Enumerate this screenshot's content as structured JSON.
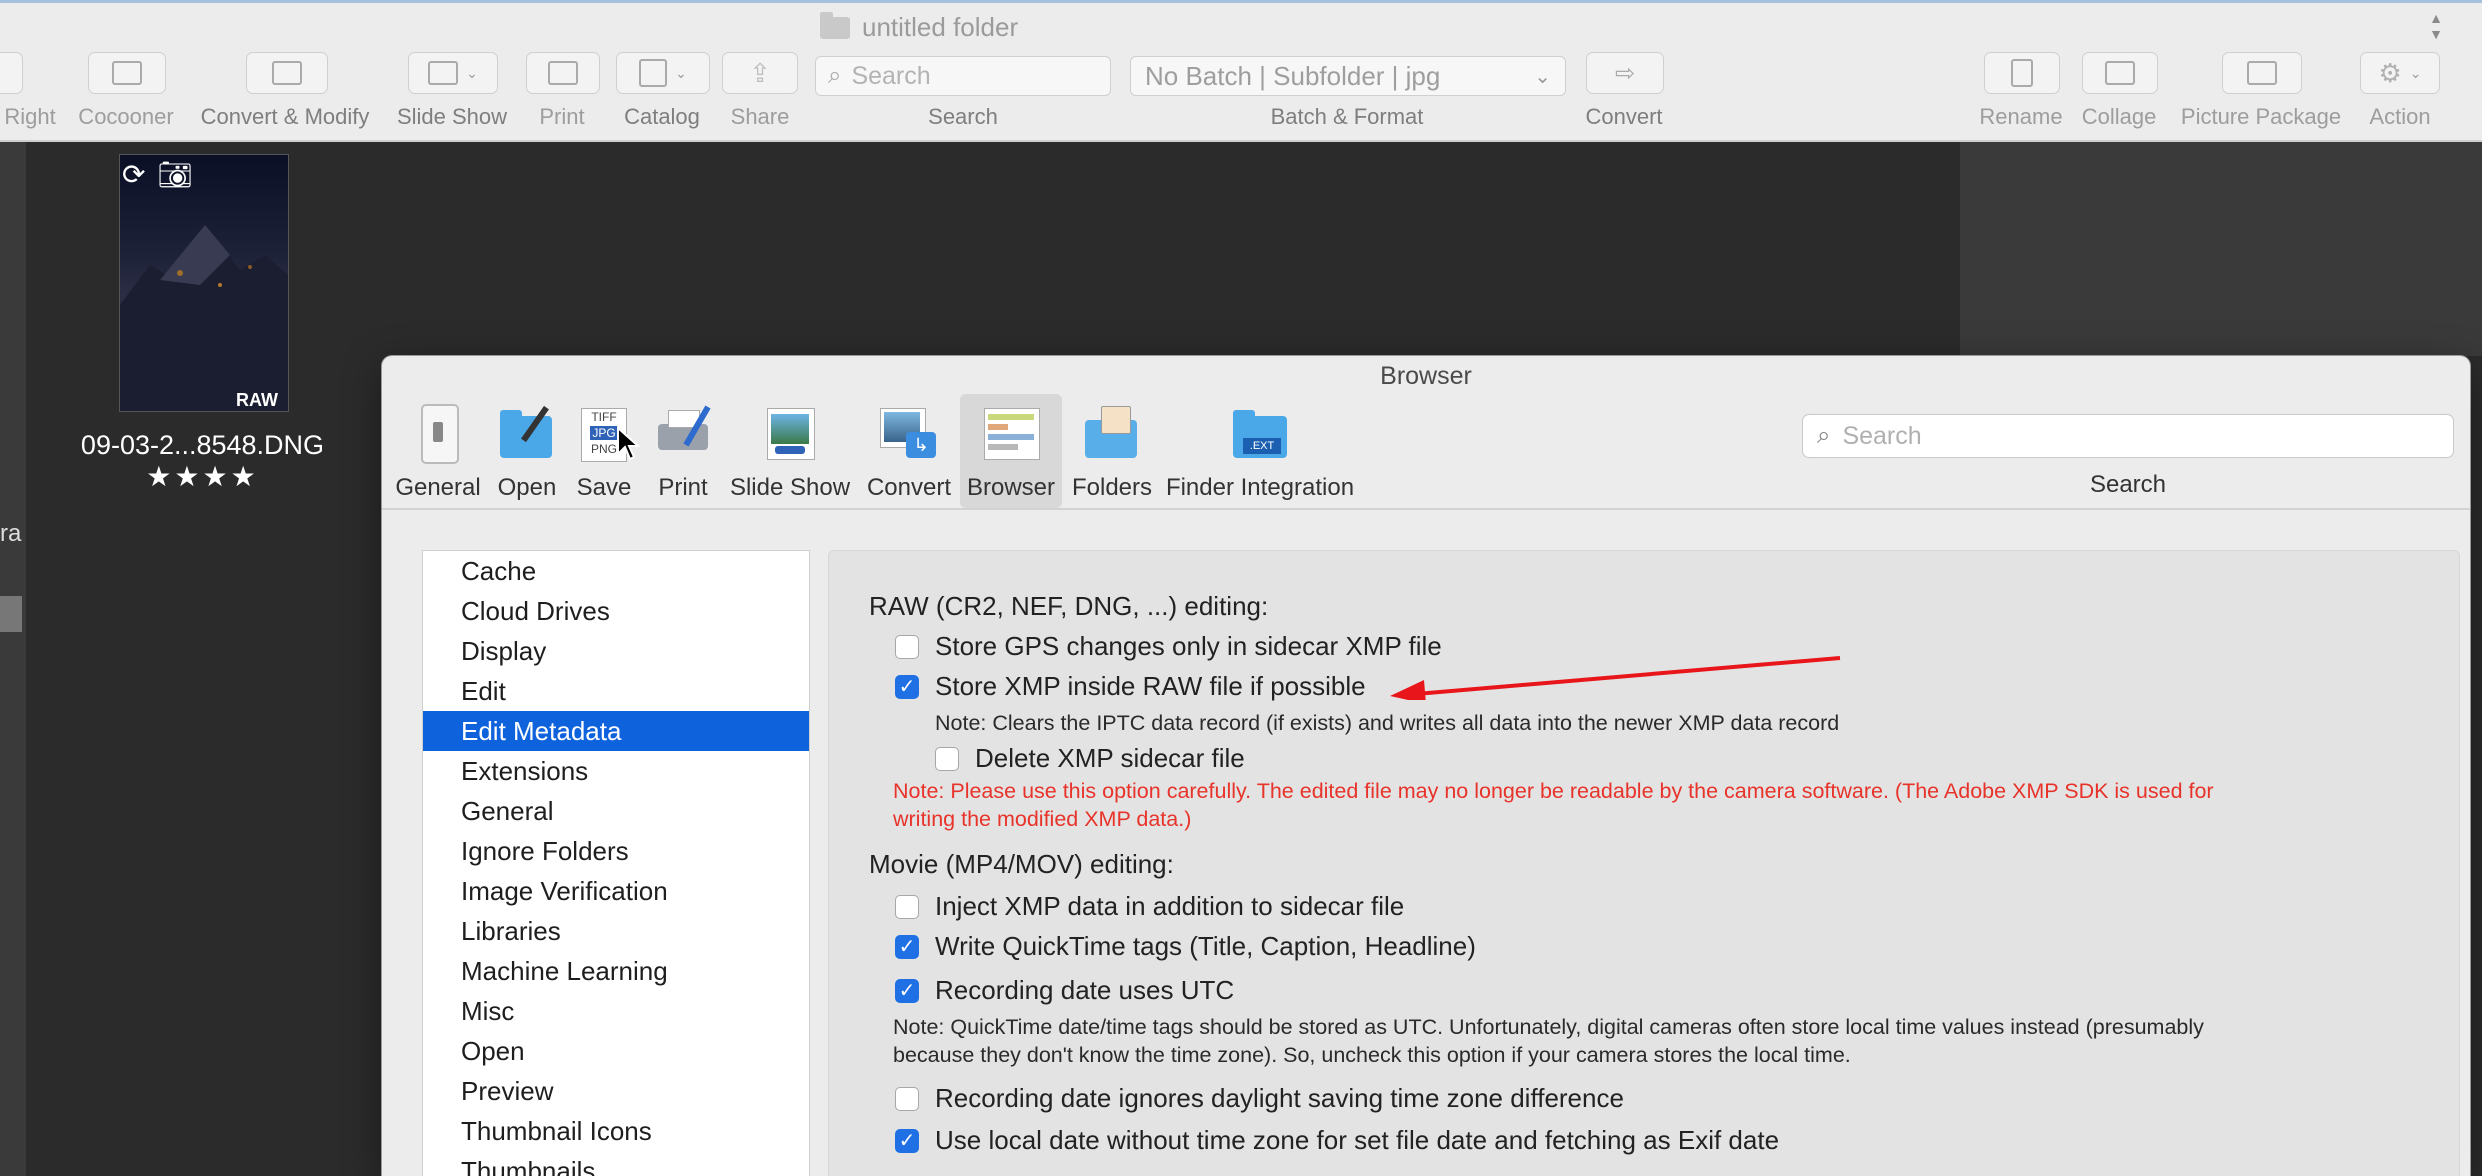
{
  "window": {
    "title": "untitled folder"
  },
  "toolbar": {
    "items": [
      {
        "label": "Right"
      },
      {
        "label": "Cocooner"
      },
      {
        "label": "Convert & Modify"
      },
      {
        "label": "Slide Show"
      },
      {
        "label": "Print"
      },
      {
        "label": "Catalog"
      },
      {
        "label": "Share"
      },
      {
        "label": "Search"
      },
      {
        "label": "Batch & Format"
      },
      {
        "label": "Convert"
      },
      {
        "label": "Rename"
      },
      {
        "label": "Collage"
      },
      {
        "label": "Picture Package"
      },
      {
        "label": "Action"
      }
    ],
    "search_placeholder": "Search",
    "batch_value": "No Batch | Subfolder | jpg"
  },
  "browser_area": {
    "left_text": "ra",
    "thumbnail": {
      "filename": "09-03-2...8548.DNG",
      "badge": "RAW",
      "rating_stars": "★★★★"
    }
  },
  "prefs": {
    "title": "Browser",
    "tabs": [
      {
        "label": "General"
      },
      {
        "label": "Open"
      },
      {
        "label": "Save"
      },
      {
        "label": "Print"
      },
      {
        "label": "Slide Show"
      },
      {
        "label": "Convert"
      },
      {
        "label": "Browser"
      },
      {
        "label": "Folders"
      },
      {
        "label": "Finder Integration"
      }
    ],
    "search": {
      "placeholder": "Search",
      "label": "Search"
    },
    "sidebar": [
      "Cache",
      "Cloud Drives",
      "Display",
      "Edit",
      "Edit Metadata",
      "Extensions",
      "General",
      "Ignore Folders",
      "Image Verification",
      "Libraries",
      "Machine Learning",
      "Misc",
      "Open",
      "Preview",
      "Thumbnail Icons",
      "Thumbnails"
    ],
    "content": {
      "raw_heading": "RAW (CR2, NEF, DNG, ...) editing:",
      "gps_sidecar": "Store GPS changes only in sidecar XMP file",
      "store_xmp_raw": "Store XMP inside RAW file if possible",
      "iptc_note": "Note: Clears the IPTC data record (if exists) and writes all data into the newer XMP data record",
      "delete_sidecar": "Delete XMP sidecar file",
      "warning_line1": "Note: Please use this option carefully. The edited file may no longer be readable by the camera software. (The Adobe XMP SDK is used for",
      "warning_line2": "writing the modified XMP data.)",
      "movie_heading": "Movie (MP4/MOV) editing:",
      "inject_xmp": "Inject XMP data in addition to sidecar file",
      "quicktime_tags": "Write QuickTime tags (Title, Caption, Headline)",
      "recording_utc": "Recording date uses UTC",
      "utc_note_line1": "Note: QuickTime date/time tags should be stored as UTC. Unfortunately, digital cameras often store local time values instead (presumably",
      "utc_note_line2": "because they don't know the time zone). So, uncheck this option if your camera stores the local time.",
      "ignore_dst": "Recording date ignores daylight saving time zone difference",
      "local_date": "Use local date without time zone for set file date and fetching as Exif date"
    },
    "checkbox_states": {
      "gps_sidecar": false,
      "store_xmp_raw": true,
      "delete_sidecar": false,
      "inject_xmp": false,
      "quicktime_tags": true,
      "recording_utc": true,
      "ignore_dst": false,
      "local_date": true
    }
  },
  "colors": {
    "selection_blue": "#0e63dd",
    "checkbox_blue": "#1f6fe5",
    "warning_red": "#e8332a",
    "annotation_arrow": "#e8161b"
  }
}
